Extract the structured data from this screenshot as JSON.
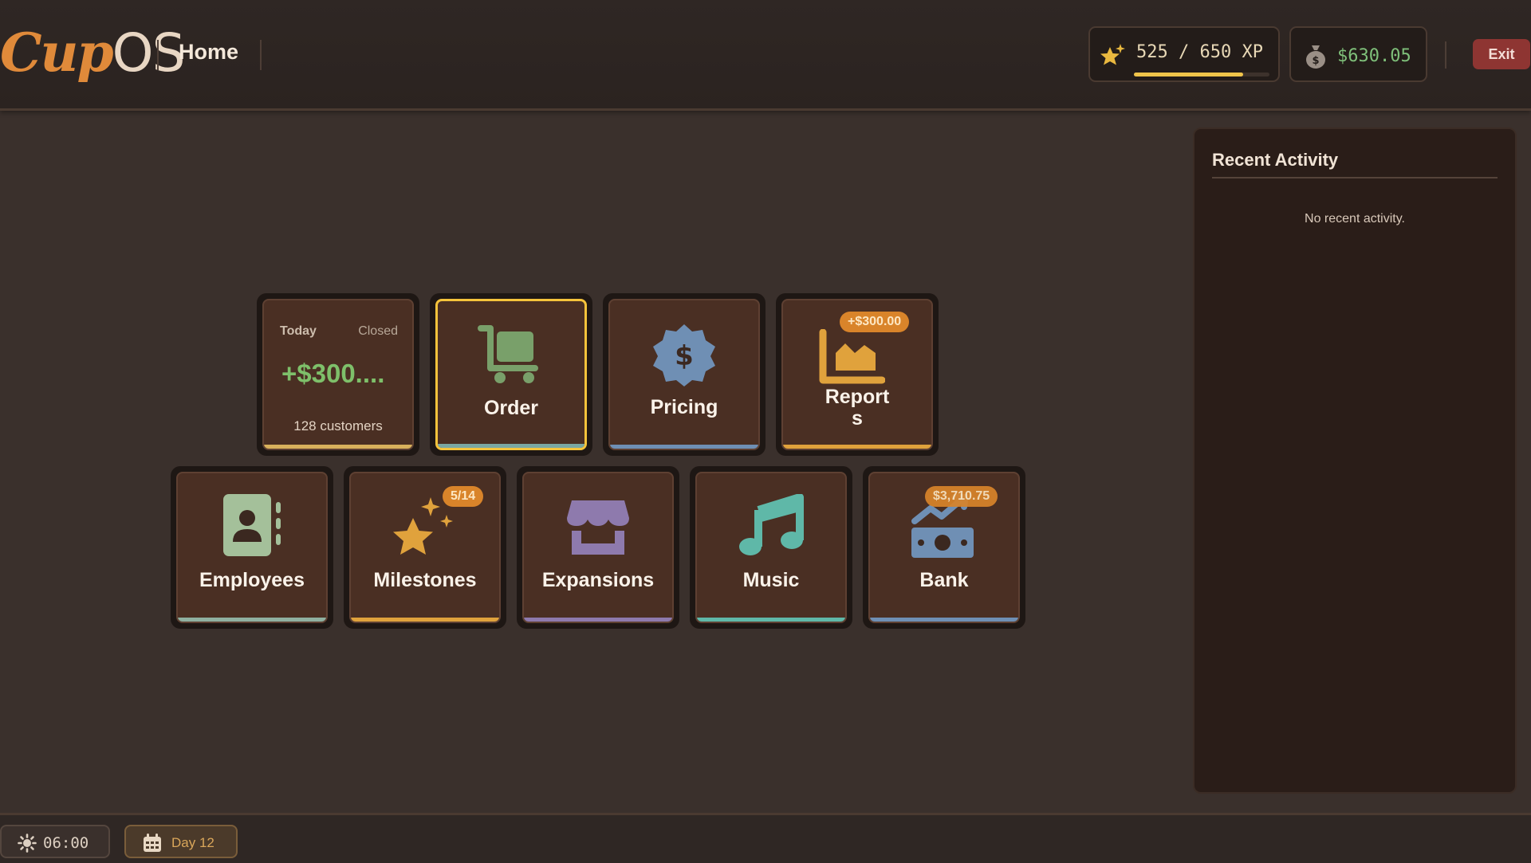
{
  "app": {
    "logo_cup": "Cup",
    "logo_os": "OS",
    "page_title": "Home"
  },
  "header": {
    "xp_text": "525 / 650 XP",
    "xp_progress": 0.808,
    "money_text": "$630.05",
    "exit_label": "Exit"
  },
  "tiles": {
    "today": {
      "label": "Today",
      "status": "Closed",
      "amount": "+$300....",
      "customers": "128 customers"
    },
    "order": {
      "label": "Order",
      "icon": "cart-icon"
    },
    "pricing": {
      "label": "Pricing",
      "icon": "dollar-badge-icon"
    },
    "reports": {
      "label_line1": "Report",
      "label_line2": "s",
      "badge": "+$300.00",
      "icon": "chart-icon"
    },
    "employees": {
      "label": "Employees",
      "icon": "contact-book-icon"
    },
    "milestones": {
      "label": "Milestones",
      "badge": "5/14",
      "icon": "star-sparkle-icon"
    },
    "expansions": {
      "label": "Expansions",
      "icon": "storefront-icon"
    },
    "music": {
      "label": "Music",
      "icon": "music-note-icon"
    },
    "bank": {
      "label": "Bank",
      "badge": "$3,710.75",
      "icon": "money-growth-icon"
    }
  },
  "activity": {
    "title": "Recent Activity",
    "empty_text": "No recent activity."
  },
  "footer": {
    "time": "06:00",
    "day": "Day 12"
  },
  "colors": {
    "accent_orange": "#e08a3a",
    "money_green": "#7fc07a",
    "selected_border": "#f5c33b",
    "exit_red": "#8e3532",
    "badge_orange": "#d9842a"
  }
}
